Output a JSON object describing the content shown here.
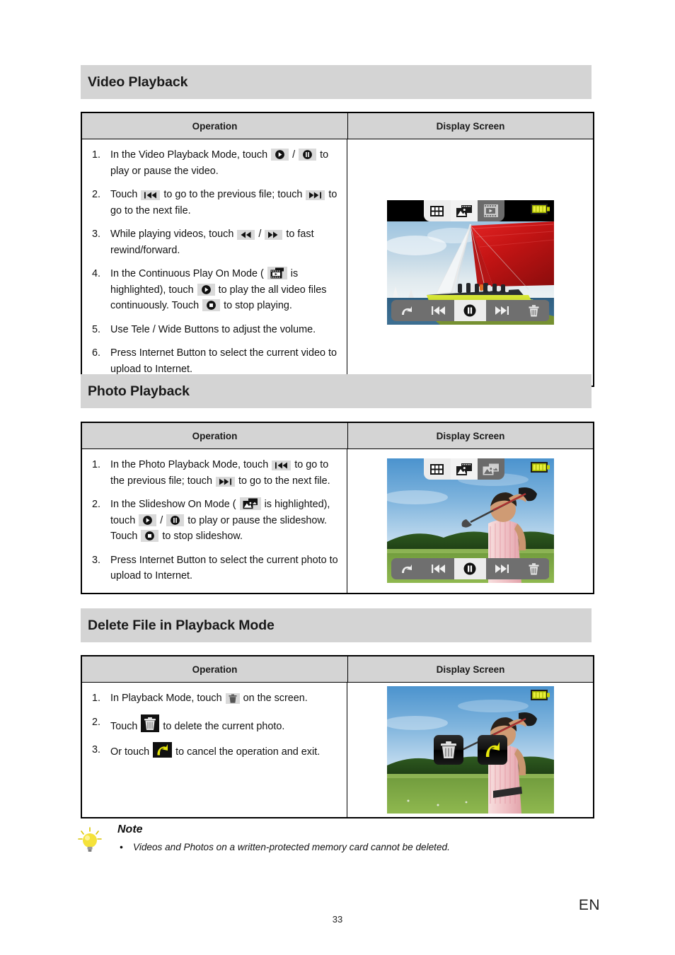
{
  "page": {
    "number": "33",
    "language": "EN"
  },
  "sections": [
    {
      "heading": "Video Playback",
      "columns": {
        "operation": "Operation",
        "display": "Display Screen"
      },
      "steps": [
        {
          "parts": [
            {
              "t": "text",
              "v": "In the Video Playback Mode, touch "
            },
            {
              "t": "icon",
              "v": "play-icon"
            },
            {
              "t": "text",
              "v": " / "
            },
            {
              "t": "icon",
              "v": "pause-icon"
            },
            {
              "t": "text",
              "v": " to play or pause the video."
            }
          ]
        },
        {
          "parts": [
            {
              "t": "text",
              "v": "Touch "
            },
            {
              "t": "icon",
              "v": "previous-icon"
            },
            {
              "t": "text",
              "v": " to go to the previous file; touch "
            },
            {
              "t": "icon",
              "v": "next-icon"
            },
            {
              "t": "text",
              "v": " to go to the next file."
            }
          ]
        },
        {
          "parts": [
            {
              "t": "text",
              "v": "While playing videos, touch "
            },
            {
              "t": "icon",
              "v": "rewind-icon"
            },
            {
              "t": "text",
              "v": " / "
            },
            {
              "t": "icon",
              "v": "forward-icon"
            },
            {
              "t": "text",
              "v": " to fast rewind/forward."
            }
          ]
        },
        {
          "parts": [
            {
              "t": "text",
              "v": "In the Continuous Play On Mode ( "
            },
            {
              "t": "icon",
              "v": "continuous-play-icon"
            },
            {
              "t": "text",
              "v": " is highlighted), touch "
            },
            {
              "t": "icon",
              "v": "play-icon"
            },
            {
              "t": "text",
              "v": " to play the all video files continuously. Touch "
            },
            {
              "t": "icon",
              "v": "stop-icon"
            },
            {
              "t": "text",
              "v": " to stop playing."
            }
          ]
        },
        {
          "parts": [
            {
              "t": "text",
              "v": "Use Tele / Wide Buttons to adjust the volume."
            }
          ]
        },
        {
          "parts": [
            {
              "t": "text",
              "v": "Press Internet Button to select the current video to upload to Internet."
            }
          ]
        }
      ],
      "screen": {
        "type": "video-playback",
        "photo_description": "racing sailboat with large red sail and yellow hull on blue ocean",
        "toolbar": [
          "thumbnail-grid-icon",
          "photo-playback-icon",
          "video-playback-icon"
        ],
        "active_toolbar_index": 2,
        "controls": [
          "back-icon",
          "previous-icon",
          "pause-icon",
          "next-icon",
          "trash-icon"
        ],
        "active_control_index": 2,
        "battery": "battery-full-icon"
      }
    },
    {
      "heading": "Photo Playback",
      "columns": {
        "operation": "Operation",
        "display": "Display Screen"
      },
      "steps": [
        {
          "parts": [
            {
              "t": "text",
              "v": "In the Photo Playback Mode, touch "
            },
            {
              "t": "icon",
              "v": "previous-icon"
            },
            {
              "t": "text",
              "v": " to go to the previous file; touch "
            },
            {
              "t": "icon",
              "v": "next-icon"
            },
            {
              "t": "text",
              "v": " to go to the next file."
            }
          ]
        },
        {
          "parts": [
            {
              "t": "text",
              "v": "In the Slideshow On Mode ( "
            },
            {
              "t": "icon",
              "v": "slideshow-icon"
            },
            {
              "t": "text",
              "v": " is highlighted), touch "
            },
            {
              "t": "icon",
              "v": "play-icon"
            },
            {
              "t": "text",
              "v": " / "
            },
            {
              "t": "icon",
              "v": "pause-icon"
            },
            {
              "t": "text",
              "v": " to play or pause the slideshow. Touch "
            },
            {
              "t": "icon",
              "v": "stop-icon"
            },
            {
              "t": "text",
              "v": " to stop slideshow."
            }
          ]
        },
        {
          "parts": [
            {
              "t": "text",
              "v": "Press Internet Button to select the current photo to upload to Internet."
            }
          ]
        }
      ],
      "screen": {
        "type": "photo-playback",
        "photo_description": "golfer in pink striped polo shirt mid swing on green fairway",
        "toolbar": [
          "thumbnail-grid-icon",
          "photo-playback-icon",
          "slideshow-icon"
        ],
        "active_toolbar_index": 2,
        "controls": [
          "back-icon",
          "previous-icon",
          "pause-icon",
          "next-icon",
          "trash-icon"
        ],
        "active_control_index": 2,
        "battery": "battery-full-icon"
      }
    },
    {
      "heading": "Delete File in Playback Mode",
      "columns": {
        "operation": "Operation",
        "display": "Display Screen"
      },
      "steps": [
        {
          "parts": [
            {
              "t": "text",
              "v": "In Playback Mode, touch "
            },
            {
              "t": "icon",
              "v": "trash-small-icon"
            },
            {
              "t": "text",
              "v": " on the screen."
            }
          ]
        },
        {
          "parts": [
            {
              "t": "text",
              "v": "Touch "
            },
            {
              "t": "icon",
              "v": "trash-dark-icon"
            },
            {
              "t": "text",
              "v": " to delete the current photo."
            }
          ]
        },
        {
          "parts": [
            {
              "t": "text",
              "v": "Or touch "
            },
            {
              "t": "icon",
              "v": "undo-dark-icon"
            },
            {
              "t": "text",
              "v": " to cancel the operation and exit."
            }
          ]
        }
      ],
      "screen": {
        "type": "delete-confirm",
        "photo_description": "golfer in pink striped polo shirt mid swing on green fairway",
        "overlay_buttons": [
          "trash-icon",
          "undo-icon"
        ],
        "battery": "battery-full-icon"
      }
    }
  ],
  "note": {
    "title": "Note",
    "items": [
      "Videos and Photos on a written-protected memory card cannot be deleted."
    ]
  },
  "colors": {
    "section_bar": "#d4d4d4",
    "table_header": "#d4d4d4",
    "border": "#000000",
    "chip_bg": "#d9d9d9",
    "accent_yellow": "#e8e805"
  }
}
